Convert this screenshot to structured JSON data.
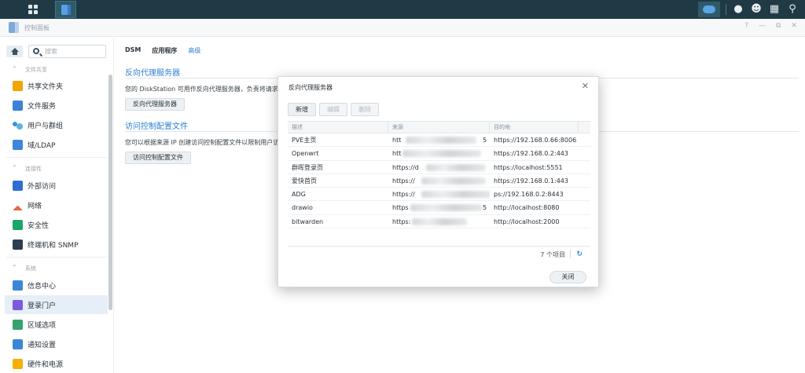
{
  "window": {
    "title": "控制面板",
    "controls": [
      "?",
      "—",
      "⧉",
      "✕"
    ]
  },
  "sidebar": {
    "search_placeholder": "搜索",
    "sections": [
      {
        "label": "文件共享"
      },
      {
        "label": "连接性"
      },
      {
        "label": "系统"
      }
    ],
    "items": [
      {
        "label": "共享文件夹",
        "icon": "shared-folder-icon"
      },
      {
        "label": "文件服务",
        "icon": "file-services-icon"
      },
      {
        "label": "用户与群组",
        "icon": "users-icon"
      },
      {
        "label": "域/LDAP",
        "icon": "ldap-icon"
      },
      {
        "label": "外部访问",
        "icon": "external-access-icon"
      },
      {
        "label": "网络",
        "icon": "network-icon"
      },
      {
        "label": "安全性",
        "icon": "security-shield-icon"
      },
      {
        "label": "终端机和 SNMP",
        "icon": "terminal-icon"
      },
      {
        "label": "信息中心",
        "icon": "info-icon"
      },
      {
        "label": "登录门户",
        "icon": "login-portal-icon"
      },
      {
        "label": "区域选项",
        "icon": "regional-icon"
      },
      {
        "label": "通知设置",
        "icon": "notification-icon"
      },
      {
        "label": "硬件和电源",
        "icon": "power-bulb-icon"
      }
    ]
  },
  "main": {
    "tabs": [
      {
        "label": "DSM"
      },
      {
        "label": "应用程序"
      },
      {
        "label": "高级",
        "active": true
      }
    ],
    "reverse_proxy": {
      "title": "反向代理服务器",
      "description": "您的 DiskStation 可用作反向代理服务器，负责将请求从",
      "button": "反向代理服务器"
    },
    "access_control": {
      "title": "访问控制配置文件",
      "description": "您可以根据来源 IP 创建访问控制配置文件以限制用户访问",
      "button": "访问控制配置文件"
    }
  },
  "modal": {
    "title": "反向代理服务器",
    "toolbar": {
      "add": "新增",
      "edit": "编辑",
      "delete": "删除"
    },
    "columns": [
      "描述",
      "来源",
      "目的地"
    ],
    "rows": [
      {
        "description": "PVE主页",
        "source": "htt",
        "source_tail": "5",
        "destination": "https://192.168.0.66:8006"
      },
      {
        "description": "Openwrt",
        "source": "htt",
        "source_tail": "",
        "destination": "https://192.168.0.2:443"
      },
      {
        "description": "群晖登录页",
        "source": "https://d",
        "source_tail": "",
        "destination": "https://localhost:5551"
      },
      {
        "description": "爱快首页",
        "source": "https://",
        "source_tail": "",
        "destination": "https://192.168.0.1:443"
      },
      {
        "description": "ADG",
        "source": "https://",
        "source_tail": "",
        "destination": "ps://192.168.0.2:8443"
      },
      {
        "description": "drawio",
        "source": "https",
        "source_tail": "5",
        "destination": "http://localhost:8080"
      },
      {
        "description": "bitwarden",
        "source": "https:",
        "source_tail": "",
        "destination": "http://localhost:2000"
      }
    ],
    "count": "7 个项目",
    "close_button": "关闭"
  },
  "colors": {
    "accent": "#2e7fd6",
    "taskbar": "#1f3a44"
  }
}
